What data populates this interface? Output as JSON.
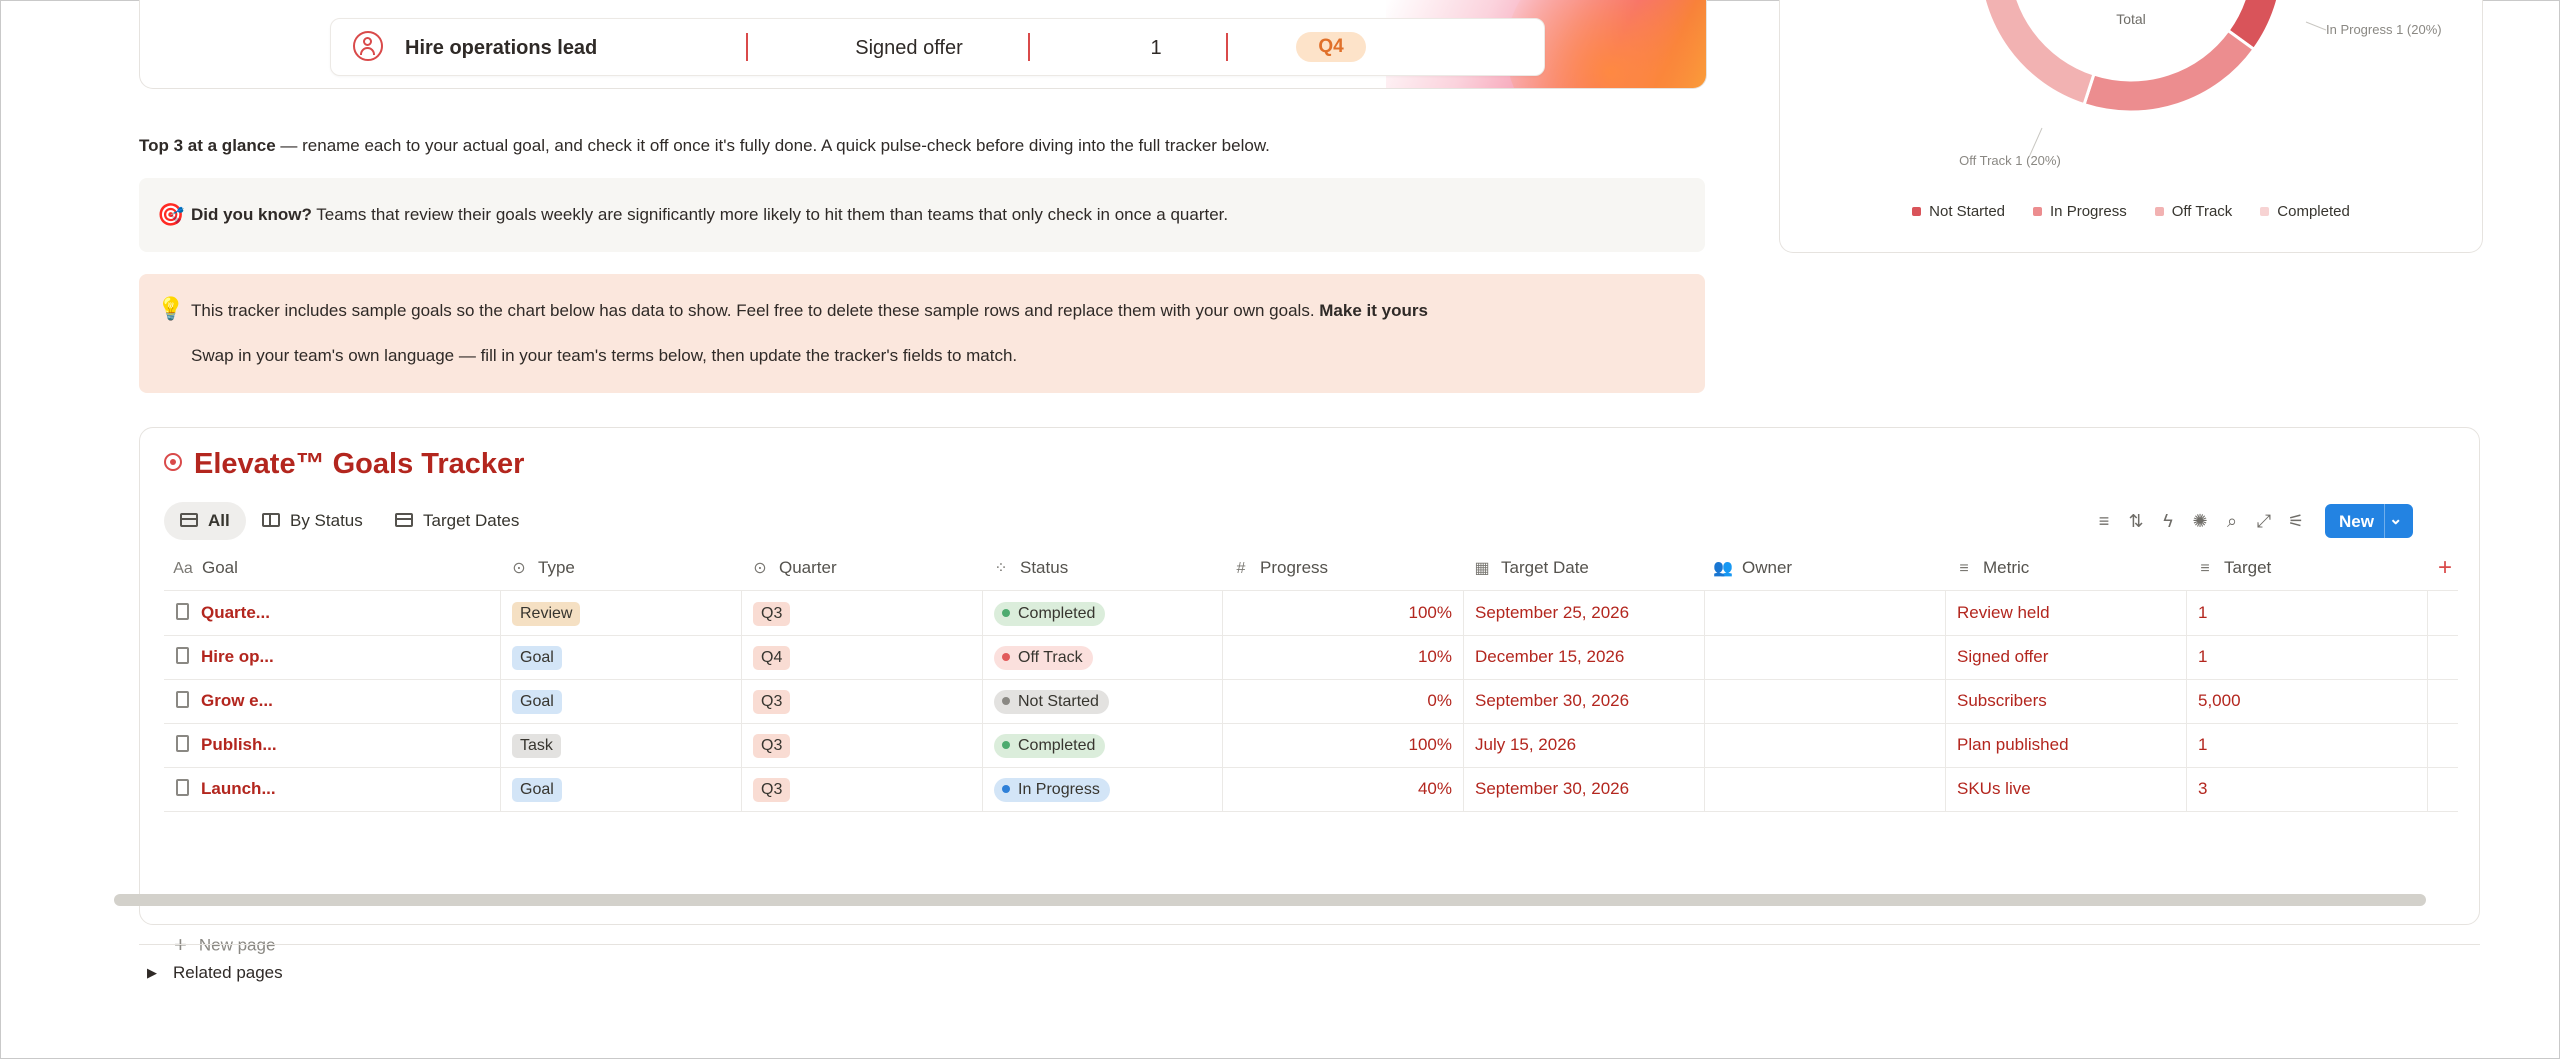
{
  "top_goal": {
    "name": "Hire operations lead",
    "metric": "Signed offer",
    "target": "1",
    "quarter": "Q4"
  },
  "intro": {
    "bold": "Top 3 at a glance",
    "rest": " — rename each to your actual goal, and check it off once it's fully done. A quick pulse-check before diving into the full tracker below."
  },
  "callout_tip": {
    "icon": "🎯",
    "bold": "Did you know?",
    "text": " Teams that review their goals weekly are significantly more likely to hit them than teams that only check in once a quarter."
  },
  "callout_info": {
    "icon": "💡",
    "line1_text": "This tracker includes sample goals so the chart below has data to show. Feel free to delete these sample rows and replace them with your own goals. ",
    "line1_bold": "Make it yours",
    "line2": "Swap in your team's own language — fill in your team's terms below, then update the tracker's fields to match."
  },
  "chart_data": {
    "type": "pie",
    "center_label": "Total",
    "slices": [
      {
        "name": "Not Started",
        "value": 1,
        "color": "#d9545a"
      },
      {
        "name": "In Progress",
        "value": 1,
        "color": "#ec8d8f"
      },
      {
        "name": "Off Track",
        "value": 1,
        "color": "#f2b2b2"
      },
      {
        "name": "Completed",
        "value": 2,
        "color": "#f7d3d3"
      }
    ],
    "visible_labels": [
      {
        "text": "In Progress",
        "value": "1 (20%)"
      },
      {
        "text": "Off Track",
        "value": "1 (20%)"
      }
    ],
    "legend": [
      "Not Started",
      "In Progress",
      "Off Track",
      "Completed"
    ],
    "legend_position": "bottom"
  },
  "database": {
    "title": "Elevate™ Goals Tracker",
    "tabs": [
      {
        "label": "All",
        "active": true
      },
      {
        "label": "By Status",
        "active": false
      },
      {
        "label": "Target Dates",
        "active": false
      }
    ],
    "new_button": "New",
    "columns": [
      "Goal",
      "Type",
      "Quarter",
      "Status",
      "Progress",
      "Target Date",
      "Owner",
      "Metric",
      "Target"
    ],
    "rows": [
      {
        "goal": "Quarte...",
        "type": "Review",
        "quarter": "Q3",
        "status": "Completed",
        "progress": "100%",
        "date": "September 25, 2026",
        "owner": "",
        "metric": "Review held",
        "target": "1"
      },
      {
        "goal": "Hire op...",
        "type": "Goal",
        "quarter": "Q4",
        "status": "Off Track",
        "progress": "10%",
        "date": "December 15, 2026",
        "owner": "",
        "metric": "Signed offer",
        "target": "1"
      },
      {
        "goal": "Grow e...",
        "type": "Goal",
        "quarter": "Q3",
        "status": "Not Started",
        "progress": "0%",
        "date": "September 30, 2026",
        "owner": "",
        "metric": "Subscribers",
        "target": "5,000"
      },
      {
        "goal": "Publish...",
        "type": "Task",
        "quarter": "Q3",
        "status": "Completed",
        "progress": "100%",
        "date": "July 15, 2026",
        "owner": "",
        "metric": "Plan published",
        "target": "1"
      },
      {
        "goal": "Launch...",
        "type": "Goal",
        "quarter": "Q3",
        "status": "In Progress",
        "progress": "40%",
        "date": "September 30, 2026",
        "owner": "",
        "metric": "SKUs live",
        "target": "3"
      }
    ],
    "new_page": "New page"
  },
  "colors": {
    "type_pill": {
      "Review": "#f5e0c3",
      "Goal": "#d3e5f7",
      "Task": "#e3e2e0"
    },
    "quarter_pill": "#f9dcd3",
    "status": {
      "Completed": {
        "bg": "#dbeddb",
        "dot": "#4dab6f"
      },
      "Off Track": {
        "bg": "#fbe0dd",
        "dot": "#e15a5a"
      },
      "Not Started": {
        "bg": "#e3e2e0",
        "dot": "#8a8883"
      },
      "In Progress": {
        "bg": "#d3e5f7",
        "dot": "#2f80d8"
      }
    }
  },
  "related": "Related pages"
}
